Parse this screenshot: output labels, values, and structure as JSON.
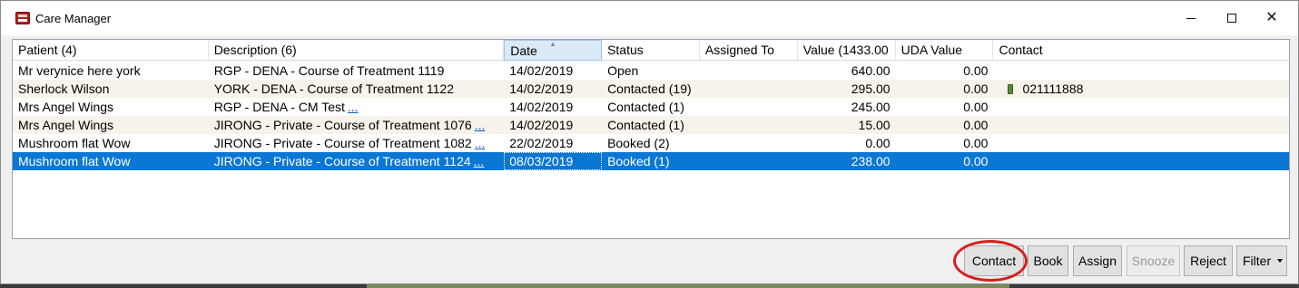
{
  "window": {
    "title": "Care Manager",
    "icon": "care-manager-app-icon"
  },
  "columns": [
    {
      "label": "Patient (4)"
    },
    {
      "label": "Description (6)"
    },
    {
      "label": "Date",
      "sorted": "ascending"
    },
    {
      "label": "Status"
    },
    {
      "label": "Assigned To"
    },
    {
      "label": "Value (1433.00"
    },
    {
      "label": "UDA Value"
    },
    {
      "label": "Contact"
    }
  ],
  "rows": [
    {
      "patient": "Mr verynice here york",
      "description": "RGP - DENA - Course of Treatment 1119",
      "more": "",
      "date": "14/02/2019",
      "status": "Open",
      "assigned": "",
      "value": "640.00",
      "uda": "0.00",
      "contact": ""
    },
    {
      "patient": "Sherlock Wilson",
      "description": "YORK - DENA - Course of Treatment 1122",
      "more": "",
      "date": "14/02/2019",
      "status": "Contacted  (19)",
      "assigned": "",
      "value": "295.00",
      "uda": "0.00",
      "contact": "021111888"
    },
    {
      "patient": "Mrs Angel Wings",
      "description": "RGP - DENA - CM Test",
      "more": "...",
      "date": "14/02/2019",
      "status": "Contacted  (1)",
      "assigned": "",
      "value": "245.00",
      "uda": "0.00",
      "contact": ""
    },
    {
      "patient": "Mrs Angel Wings",
      "description": "JIRONG - Private - Course of Treatment 1076",
      "more": "...",
      "date": "14/02/2019",
      "status": "Contacted  (1)",
      "assigned": "",
      "value": "15.00",
      "uda": "0.00",
      "contact": ""
    },
    {
      "patient": "Mushroom flat Wow",
      "description": "JIRONG - Private - Course of Treatment 1082",
      "more": "...",
      "date": "22/02/2019",
      "status": "Booked  (2)",
      "assigned": "",
      "value": "0.00",
      "uda": "0.00",
      "contact": ""
    },
    {
      "patient": "Mushroom flat Wow",
      "description": "JIRONG - Private - Course of Treatment 1124",
      "more": "...",
      "date": "08/03/2019",
      "status": "Booked  (1)",
      "assigned": "",
      "value": "238.00",
      "uda": "0.00",
      "contact": "",
      "selected": true
    }
  ],
  "buttons": {
    "contact": "Contact",
    "book": "Book",
    "assign": "Assign",
    "snooze": "Snooze",
    "reject": "Reject",
    "filter": "Filter"
  },
  "colors": {
    "selection": "#0b77d4",
    "highlight_ring": "#d81e1e"
  }
}
